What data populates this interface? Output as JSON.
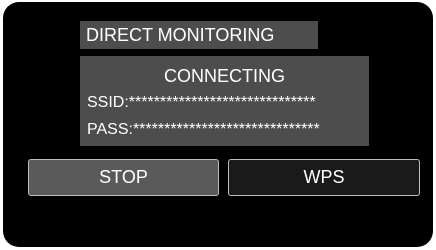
{
  "title": "DIRECT MONITORING",
  "status": "CONNECTING",
  "ssid": {
    "label": "SSID:",
    "value": "******************************"
  },
  "pass": {
    "label": "PASS:",
    "value": "******************************"
  },
  "buttons": {
    "stop": "STOP",
    "wps": "WPS"
  }
}
